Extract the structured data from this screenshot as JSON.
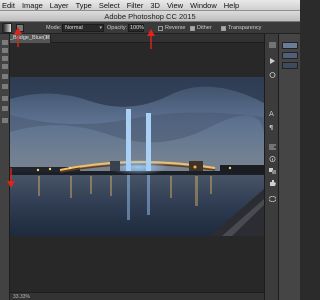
{
  "menubar": {
    "items": [
      "Edit",
      "Image",
      "Layer",
      "Type",
      "Select",
      "Filter",
      "3D",
      "View",
      "Window",
      "Help"
    ]
  },
  "window": {
    "title": "Adobe Photoshop CC 2015"
  },
  "options": {
    "mode_label": "Mode:",
    "mode_value": "Normal",
    "opacity_label": "Opacity:",
    "opacity_value": "100%",
    "reverse_label": "Reverse",
    "dither_label": "Dither",
    "transparency_label": "Transparency"
  },
  "document": {
    "tab_label": "_Bridge_Blue(16)",
    "close_glyph": "×"
  },
  "status": {
    "zoom": "33.33%"
  },
  "colors": {
    "annotation": "#e0241c",
    "foreground_swatch": "#000000",
    "background_swatch": "#ffffff"
  }
}
